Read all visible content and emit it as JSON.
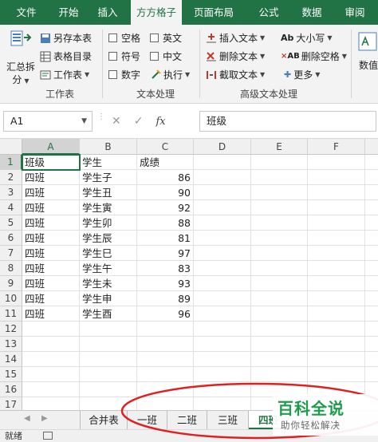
{
  "ribbon_tabs": [
    "文件",
    "开始",
    "插入",
    "方方格子",
    "页面布局",
    "公式",
    "数据",
    "审阅"
  ],
  "active_tab_index": 3,
  "ribbon": {
    "workbook_group": {
      "big_button_line1": "汇总拆",
      "big_button_line2": "分",
      "save_copy": "另存本表",
      "sheet_index": "表格目录",
      "worksheet": "工作表",
      "label": "工作表"
    },
    "text_group": {
      "space": "空格",
      "english": "英文",
      "symbol": "符号",
      "chinese": "中文",
      "number": "数字",
      "execute": "执行",
      "label": "文本处理"
    },
    "advanced_group": {
      "insert_text": "插入文本",
      "delete_text": "删除文本",
      "extract_text": "截取文本",
      "case": "大小写",
      "delete_space": "删除空格",
      "more": "更多",
      "label": "高级文本处理"
    },
    "cut_label": "数值"
  },
  "formula_bar": {
    "name_box": "A1",
    "cancel_icon": "✕",
    "confirm_icon": "✓",
    "fx": "fx",
    "value": "班级"
  },
  "columns": [
    "A",
    "B",
    "C",
    "D",
    "E",
    "F"
  ],
  "rows": [
    [
      "班级",
      "学生",
      "成绩"
    ],
    [
      "四班",
      "学生子",
      "86"
    ],
    [
      "四班",
      "学生丑",
      "90"
    ],
    [
      "四班",
      "学生寅",
      "92"
    ],
    [
      "四班",
      "学生卯",
      "88"
    ],
    [
      "四班",
      "学生辰",
      "81"
    ],
    [
      "四班",
      "学生巳",
      "97"
    ],
    [
      "四班",
      "学生午",
      "83"
    ],
    [
      "四班",
      "学生未",
      "93"
    ],
    [
      "四班",
      "学生申",
      "89"
    ],
    [
      "四班",
      "学生酉",
      "96"
    ]
  ],
  "row_numbers": [
    "1",
    "2",
    "3",
    "4",
    "5",
    "6",
    "7",
    "8",
    "9",
    "10",
    "11",
    "12",
    "13",
    "14",
    "15",
    "16",
    "17"
  ],
  "sheet_tabs": [
    "合并表",
    "一班",
    "二班",
    "三班",
    "四班"
  ],
  "active_sheet": "四班",
  "status": "就绪",
  "watermark": {
    "main": "百科全说",
    "sub": "助你轻松解决"
  },
  "colors": {
    "excel_green": "#217346",
    "annotation_red": "#e02020",
    "watermark_green": "#1e9c4b"
  }
}
